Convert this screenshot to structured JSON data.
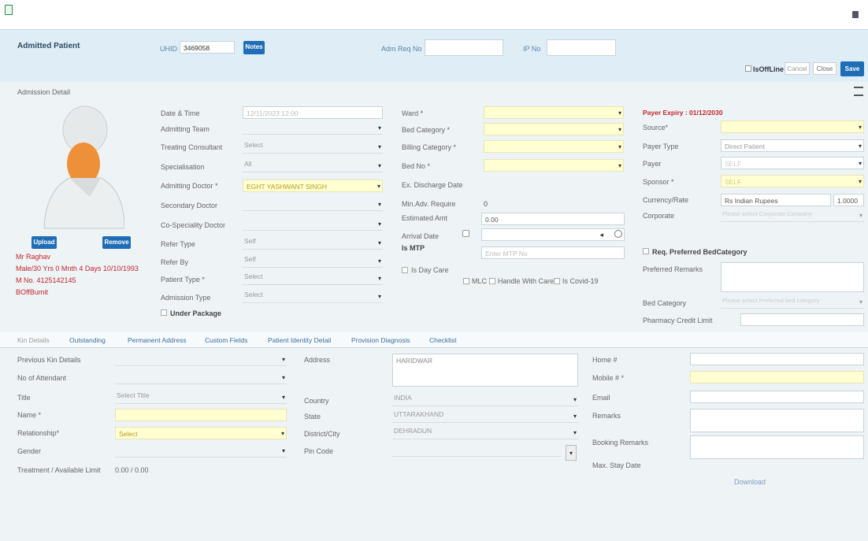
{
  "header": {
    "title": "Admitted Patient",
    "uhid_label": "UHID",
    "uhid_value": "3469058",
    "notes_label": "Notes",
    "adm_req_label": "Adm Req No",
    "ip_label": "IP No",
    "isoffline_label": "IsOffLine",
    "cancel_label": "Cancel",
    "close_label": "Close",
    "save_label": "Save"
  },
  "section": {
    "admission_detail": "Admission Detail"
  },
  "patient": {
    "upload_label": "Upload",
    "remove_label": "Remove",
    "name": "Mr Raghav",
    "details": "Male/30 Yrs 0 Mnth 4 Days 10/10/1993",
    "mobile": "M No. 4125142145",
    "status": "BOffBumit"
  },
  "col1": {
    "date_time_label": "Date & Time",
    "date_time_value": "12/11/2023 12:00",
    "admitting_team_label": "Admitting Team",
    "treating_consultant_label": "Treating Consultant",
    "treating_consultant_value": "Select",
    "specialisation_label": "Specialisation",
    "specialisation_value": "All",
    "admitting_doctor_label": "Admitting Doctor *",
    "admitting_doctor_value": "EGHT YASHWANT SINGH",
    "secondary_doctor_label": "Secondary Doctor",
    "co_speciality_label": "Co-Speciality Doctor",
    "refer_type_label": "Refer Type",
    "refer_type_value": "Self",
    "refer_by_label": "Refer By",
    "refer_by_value": "Self",
    "patient_type_label": "Patient Type *",
    "patient_type_value": "Select",
    "admission_type_label": "Admission Type",
    "admission_type_value": "Select",
    "under_package_label": "Under Package"
  },
  "col2": {
    "ward_label": "Ward *",
    "bed_category_label": "Bed Category *",
    "billing_category_label": "Billing Category *",
    "bed_no_label": "Bed No *",
    "ex_discharge_label": "Ex. Discharge Date",
    "min_adv_label": "Min.Adv. Require",
    "min_adv_value": "0",
    "estimated_amt_label": "Estimated Amt",
    "estimated_amt_value": "0.00",
    "arrival_date_label": "Arrival Date",
    "is_mtp_label": "Is MTP",
    "mtp_placeholder": "Enter MTP No",
    "is_day_care_label": "Is Day Care",
    "mlc_label": "MLC",
    "handle_with_care_label": "Handle With Care",
    "is_covid_label": "Is Covid-19"
  },
  "col3": {
    "payer_expiry": "Payer Expiry : 01/12/2030",
    "source_label": "Source*",
    "payer_type_label": "Payer Type",
    "payer_type_value": "Direct Patient",
    "payer_label": "Payer",
    "payer_value": "SELF",
    "sponsor_label": "Sponsor *",
    "sponsor_value": "SELF",
    "currency_label": "Currency/Rate",
    "currency_value": "Rs   Indian Rupees",
    "rate_value": "1.0000",
    "corporate_label": "Corporate",
    "corporate_value": "Please select Corporate Company",
    "req_pref_label": "Req. Preferred BedCategory",
    "pref_remarks_label": "Preferred Remarks",
    "bed_category_label": "Bed Category",
    "bed_category_value": "Please select Preferred bed category",
    "pharmacy_label": "Pharmacy Credit Limit"
  },
  "tabs": [
    "Kin Details",
    "Outstanding",
    "Permanent Address",
    "Custom Fields",
    "Patient Identity Detail",
    "Provision Diagnosis",
    "Checklist"
  ],
  "kin": {
    "previous_label": "Previous Kin Details",
    "no_attendant_label": "No of Attendant",
    "title_label": "Title",
    "title_value": "Select Title",
    "name_label": "Name *",
    "relationship_label": "Relationship*",
    "relationship_value": "Select",
    "gender_label": "Gender",
    "treatment_label": "Treatment / Available Limit",
    "treatment_value": "0.00 / 0.00",
    "address_label": "Address",
    "address_value": "HARIDWAR",
    "country_label": "Country",
    "country_value": "INDIA",
    "state_label": "State",
    "state_value": "UTTARAKHAND",
    "district_label": "District/City",
    "district_value": "DEHRADUN",
    "pin_label": "Pin Code",
    "home_label": "Home #",
    "mobile_label": "Mobile # *",
    "email_label": "Email",
    "remarks_label": "Remarks",
    "booking_remarks_label": "Booking Remarks",
    "max_stay_label": "Max. Stay Date",
    "download_label": "Download"
  },
  "colors": {
    "accent": "#1e6db6",
    "required_field": "#ffffd2",
    "header_band": "#dfeef6",
    "error_text": "#c0262c"
  }
}
